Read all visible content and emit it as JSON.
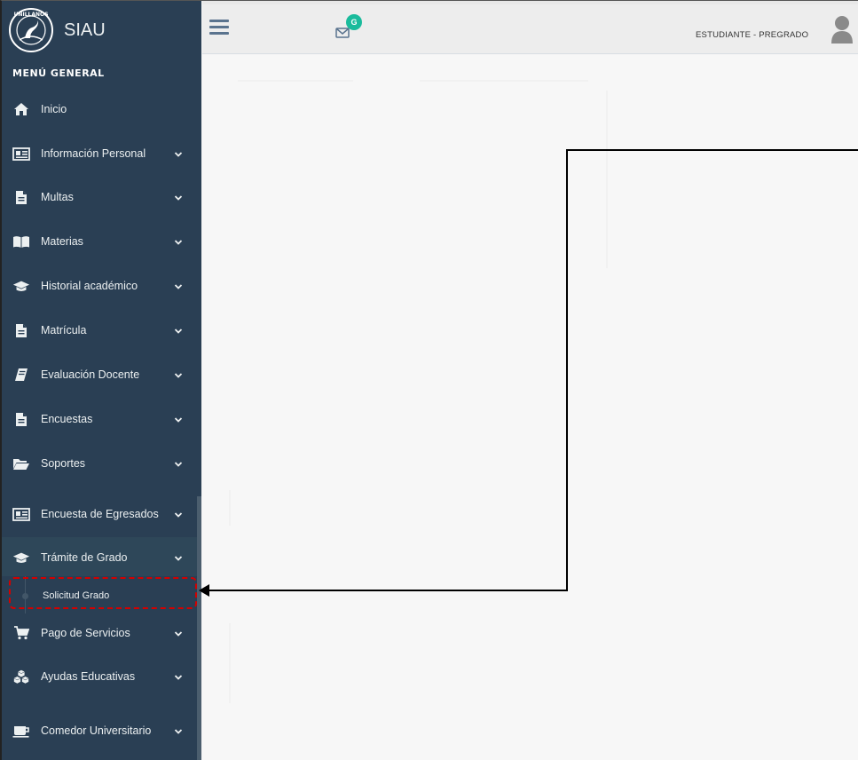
{
  "brand": {
    "name": "SIAU",
    "logo_text": "UNILLANOS"
  },
  "sidebar": {
    "menu_title": "MENÚ GENERAL",
    "items": [
      {
        "label": "Inicio",
        "icon": "home-icon",
        "has_chevron": false
      },
      {
        "label": "Información Personal",
        "icon": "id-card-icon",
        "has_chevron": true
      },
      {
        "label": "Multas",
        "icon": "file-icon",
        "has_chevron": true
      },
      {
        "label": "Materias",
        "icon": "book-icon",
        "has_chevron": true
      },
      {
        "label": "Historial académico",
        "icon": "graduation-cap-icon",
        "has_chevron": true
      },
      {
        "label": "Matrícula",
        "icon": "file-icon",
        "has_chevron": true
      },
      {
        "label": "Evaluación Docente",
        "icon": "book-tilted-icon",
        "has_chevron": true
      },
      {
        "label": "Encuestas",
        "icon": "file-icon",
        "has_chevron": true
      },
      {
        "label": "Soportes",
        "icon": "folder-open-icon",
        "has_chevron": true
      },
      {
        "label": "Encuesta de Egresados",
        "icon": "id-card-icon",
        "has_chevron": true
      },
      {
        "label": "Trámite de Grado",
        "icon": "graduation-cap-icon",
        "has_chevron": true,
        "active": true
      },
      {
        "label": "Pago de Servicios",
        "icon": "cart-icon",
        "has_chevron": true
      },
      {
        "label": "Ayudas Educativas",
        "icon": "cubes-icon",
        "has_chevron": true
      },
      {
        "label": "Comedor Universitario",
        "icon": "coffee-cup-icon",
        "has_chevron": true
      }
    ],
    "submenu": {
      "label": "Solicitud Grado"
    }
  },
  "topnav": {
    "notification_badge": "G",
    "role": "ESTUDIANTE - PREGRADO"
  },
  "colors": {
    "sidebar_bg": "#2a3f54",
    "accent": "#1abb9c",
    "highlight": "#d40000"
  }
}
